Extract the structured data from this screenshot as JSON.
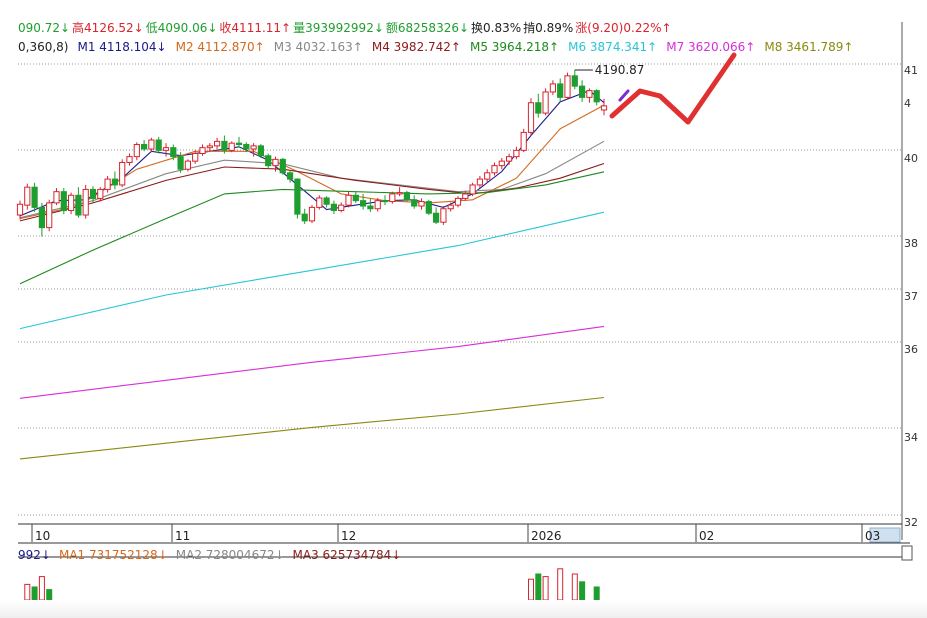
{
  "colors": {
    "up": "#d9232d",
    "down": "#1e9e2e",
    "annotation": "#e03030",
    "annotation_marker": "#7a2cd8",
    "grid": "#999999"
  },
  "top_bar": {
    "items": [
      {
        "text": "090.72↓",
        "color": "#1e9e2e"
      },
      {
        "text": "高4126.52↓",
        "color": "#d9232d"
      },
      {
        "text": "低4090.06↓",
        "color": "#1e9e2e"
      },
      {
        "text": "收4111.11↑",
        "color": "#d9232d"
      },
      {
        "text": "量393992992↓",
        "color": "#1e9e2e"
      },
      {
        "text": "额68258326↓",
        "color": "#1e9e2e"
      },
      {
        "text": "换0.83%",
        "color": "#222222"
      },
      {
        "text": "掯0.89%",
        "color": "#222222"
      },
      {
        "text": "涨(9.20)0.22%↑",
        "color": "#d9232d"
      }
    ]
  },
  "ma_bar": {
    "items": [
      {
        "text": "0,360,8)",
        "color": "#222222"
      },
      {
        "text": "M1 4118.104↓",
        "color": "#1a1a8c"
      },
      {
        "text": "M2 4112.870↑",
        "color": "#d2691e"
      },
      {
        "text": "M3 4032.163↑",
        "color": "#888888"
      },
      {
        "text": "M4 3982.742↑",
        "color": "#8b1a1a"
      },
      {
        "text": "M5 3964.218↑",
        "color": "#1e8a1e"
      },
      {
        "text": "M6 3874.341↑",
        "color": "#27c6d6"
      },
      {
        "text": "M7 3620.066↑",
        "color": "#d62fd6"
      },
      {
        "text": "M8 3461.789↑",
        "color": "#8a8a10"
      }
    ]
  },
  "vol_bar": {
    "items": [
      {
        "text": "992↓",
        "color": "#1a1a8c"
      },
      {
        "text": "MA1 731752128↓",
        "color": "#d2691e"
      },
      {
        "text": "MA2 728004672↓",
        "color": "#888888"
      },
      {
        "text": "MA3 625734784↓",
        "color": "#8b1a1a"
      }
    ]
  },
  "chart_data": {
    "type": "candlestick",
    "x_axis": {
      "tick_labels": [
        "10",
        "11",
        "12",
        "2026",
        "02",
        "03"
      ]
    },
    "y_axis": {
      "visible_tick_fragments": [
        "41",
        "4",
        "40",
        "38",
        "37",
        "36",
        "34",
        "32"
      ],
      "range": [
        3180,
        4280
      ]
    },
    "max_annotation": {
      "label": "4190.87",
      "value": 4190.87
    },
    "latest_bar": {
      "open": 4101.91,
      "high": 4126.52,
      "low": 4090.06,
      "close": 4111.11
    },
    "candles": [
      [
        3868,
        3900,
        3858,
        3892
      ],
      [
        3890,
        3938,
        3880,
        3930
      ],
      [
        3930,
        3940,
        3875,
        3885
      ],
      [
        3885,
        3895,
        3820,
        3840
      ],
      [
        3840,
        3902,
        3832,
        3895
      ],
      [
        3895,
        3928,
        3890,
        3920
      ],
      [
        3920,
        3928,
        3870,
        3878
      ],
      [
        3878,
        3918,
        3870,
        3912
      ],
      [
        3912,
        3930,
        3862,
        3868
      ],
      [
        3868,
        3935,
        3860,
        3925
      ],
      [
        3925,
        3932,
        3895,
        3905
      ],
      [
        3905,
        3930,
        3898,
        3925
      ],
      [
        3925,
        3955,
        3918,
        3948
      ],
      [
        3948,
        3965,
        3925,
        3935
      ],
      [
        3935,
        3992,
        3930,
        3985
      ],
      [
        3985,
        4005,
        3978,
        3998
      ],
      [
        3998,
        4030,
        3990,
        4025
      ],
      [
        4025,
        4035,
        4010,
        4015
      ],
      [
        4015,
        4040,
        4008,
        4035
      ],
      [
        4035,
        4042,
        4005,
        4012
      ],
      [
        4012,
        4028,
        3998,
        4018
      ],
      [
        4018,
        4025,
        3990,
        3998
      ],
      [
        3998,
        4008,
        3962,
        3970
      ],
      [
        3970,
        3992,
        3965,
        3988
      ],
      [
        3988,
        4012,
        3982,
        4005
      ],
      [
        4005,
        4025,
        4000,
        4018
      ],
      [
        4018,
        4028,
        4010,
        4022
      ],
      [
        4022,
        4040,
        4015,
        4032
      ],
      [
        4032,
        4045,
        4005,
        4012
      ],
      [
        4012,
        4032,
        4008,
        4028
      ],
      [
        4028,
        4042,
        4018,
        4025
      ],
      [
        4025,
        4030,
        4008,
        4015
      ],
      [
        4015,
        4028,
        3998,
        4022
      ],
      [
        4022,
        4026,
        3995,
        4000
      ],
      [
        4000,
        4005,
        3972,
        3978
      ],
      [
        3978,
        3998,
        3965,
        3992
      ],
      [
        3992,
        3995,
        3958,
        3962
      ],
      [
        3962,
        3968,
        3940,
        3948
      ],
      [
        3948,
        3950,
        3860,
        3870
      ],
      [
        3870,
        3882,
        3848,
        3855
      ],
      [
        3855,
        3890,
        3850,
        3885
      ],
      [
        3885,
        3912,
        3880,
        3906
      ],
      [
        3906,
        3910,
        3885,
        3892
      ],
      [
        3892,
        3900,
        3870,
        3878
      ],
      [
        3878,
        3896,
        3874,
        3890
      ],
      [
        3890,
        3920,
        3885,
        3912
      ],
      [
        3912,
        3920,
        3895,
        3900
      ],
      [
        3900,
        3915,
        3880,
        3888
      ],
      [
        3888,
        3904,
        3875,
        3882
      ],
      [
        3882,
        3906,
        3876,
        3900
      ],
      [
        3900,
        3912,
        3890,
        3898
      ],
      [
        3898,
        3920,
        3893,
        3915
      ],
      [
        3915,
        3930,
        3910,
        3918
      ],
      [
        3918,
        3922,
        3898,
        3902
      ],
      [
        3902,
        3912,
        3882,
        3888
      ],
      [
        3888,
        3905,
        3880,
        3898
      ],
      [
        3898,
        3902,
        3868,
        3872
      ],
      [
        3872,
        3885,
        3848,
        3852
      ],
      [
        3852,
        3888,
        3846,
        3882
      ],
      [
        3882,
        3896,
        3876,
        3890
      ],
      [
        3890,
        3910,
        3885,
        3905
      ],
      [
        3905,
        3922,
        3900,
        3915
      ],
      [
        3915,
        3940,
        3910,
        3935
      ],
      [
        3935,
        3955,
        3928,
        3948
      ],
      [
        3948,
        3970,
        3940,
        3962
      ],
      [
        3962,
        3985,
        3956,
        3978
      ],
      [
        3978,
        3995,
        3970,
        3988
      ],
      [
        3988,
        4005,
        3980,
        3998
      ],
      [
        3998,
        4020,
        3992,
        4012
      ],
      [
        4012,
        4060,
        4008,
        4052
      ],
      [
        4052,
        4128,
        4045,
        4118
      ],
      [
        4118,
        4138,
        4085,
        4095
      ],
      [
        4095,
        4150,
        4090,
        4142
      ],
      [
        4142,
        4168,
        4135,
        4160
      ],
      [
        4160,
        4172,
        4120,
        4130
      ],
      [
        4130,
        4185,
        4125,
        4178
      ],
      [
        4178,
        4190.87,
        4148,
        4155
      ],
      [
        4155,
        4168,
        4120,
        4130
      ],
      [
        4130,
        4150,
        4118,
        4145
      ],
      [
        4145,
        4148,
        4112,
        4120
      ],
      [
        4101.91,
        4126.52,
        4090.06,
        4111.11
      ]
    ],
    "moving_averages": [
      {
        "name": "M1",
        "color": "#1a1a8c",
        "last": 4118.104,
        "start": 3866,
        "anchors": [
          [
            0,
            3866
          ],
          [
            5,
            3900
          ],
          [
            9,
            3902
          ],
          [
            14,
            3950
          ],
          [
            18,
            4010
          ],
          [
            22,
            4000
          ],
          [
            26,
            4010
          ],
          [
            30,
            4020
          ],
          [
            34,
            3990
          ],
          [
            38,
            3935
          ],
          [
            42,
            3880
          ],
          [
            46,
            3890
          ],
          [
            50,
            3900
          ],
          [
            54,
            3902
          ],
          [
            58,
            3885
          ],
          [
            62,
            3915
          ],
          [
            66,
            3965
          ],
          [
            70,
            4045
          ],
          [
            74,
            4120
          ],
          [
            78,
            4145
          ],
          [
            80,
            4118.104
          ]
        ]
      },
      {
        "name": "M2",
        "color": "#d2691e",
        "last": 4112.87,
        "start": 3860,
        "anchors": [
          [
            0,
            3860
          ],
          [
            8,
            3888
          ],
          [
            16,
            3970
          ],
          [
            24,
            4010
          ],
          [
            32,
            4010
          ],
          [
            38,
            3965
          ],
          [
            44,
            3915
          ],
          [
            50,
            3900
          ],
          [
            56,
            3895
          ],
          [
            62,
            3902
          ],
          [
            68,
            3950
          ],
          [
            74,
            4060
          ],
          [
            80,
            4112.87
          ]
        ]
      },
      {
        "name": "M3",
        "color": "#888888",
        "last": 4032.163,
        "start": 3862,
        "anchors": [
          [
            0,
            3862
          ],
          [
            10,
            3900
          ],
          [
            20,
            3960
          ],
          [
            28,
            3990
          ],
          [
            36,
            3982
          ],
          [
            44,
            3950
          ],
          [
            52,
            3935
          ],
          [
            60,
            3920
          ],
          [
            66,
            3925
          ],
          [
            72,
            3960
          ],
          [
            80,
            4032.163
          ]
        ]
      },
      {
        "name": "M4",
        "color": "#8b1a1a",
        "last": 3982.742,
        "start": 3855,
        "anchors": [
          [
            0,
            3855
          ],
          [
            10,
            3895
          ],
          [
            20,
            3945
          ],
          [
            28,
            3975
          ],
          [
            36,
            3970
          ],
          [
            46,
            3945
          ],
          [
            56,
            3925
          ],
          [
            62,
            3915
          ],
          [
            68,
            3928
          ],
          [
            74,
            3950
          ],
          [
            80,
            3982.742
          ]
        ]
      },
      {
        "name": "M5",
        "color": "#1e8a1e",
        "last": 3964.218,
        "start": 3715,
        "anchors": [
          [
            0,
            3715
          ],
          [
            10,
            3790
          ],
          [
            20,
            3860
          ],
          [
            28,
            3915
          ],
          [
            36,
            3925
          ],
          [
            46,
            3920
          ],
          [
            56,
            3915
          ],
          [
            64,
            3918
          ],
          [
            72,
            3935
          ],
          [
            80,
            3964.218
          ]
        ]
      },
      {
        "name": "M6",
        "color": "#27c6d6",
        "last": 3874.341,
        "start": 3615,
        "anchors": [
          [
            0,
            3615
          ],
          [
            20,
            3690
          ],
          [
            40,
            3745
          ],
          [
            60,
            3800
          ],
          [
            80,
            3874.341
          ]
        ]
      },
      {
        "name": "M7",
        "color": "#d62fd6",
        "last": 3620.066,
        "start": 3460,
        "anchors": [
          [
            0,
            3460
          ],
          [
            20,
            3500
          ],
          [
            40,
            3540
          ],
          [
            60,
            3575
          ],
          [
            80,
            3620.066
          ]
        ]
      },
      {
        "name": "M8",
        "color": "#8a8a10",
        "last": 3461.789,
        "start": 3325,
        "anchors": [
          [
            0,
            3325
          ],
          [
            20,
            3360
          ],
          [
            40,
            3395
          ],
          [
            60,
            3425
          ],
          [
            80,
            3461.789
          ]
        ]
      }
    ],
    "volume": [
      {
        "i": 1,
        "v": 0.6,
        "up": true
      },
      {
        "i": 2,
        "v": 0.5,
        "up": false
      },
      {
        "i": 3,
        "v": 0.9,
        "up": true
      },
      {
        "i": 4,
        "v": 0.4,
        "up": false
      },
      {
        "i": 70,
        "v": 0.8,
        "up": true
      },
      {
        "i": 71,
        "v": 1.0,
        "up": false
      },
      {
        "i": 72,
        "v": 0.9,
        "up": true
      },
      {
        "i": 74,
        "v": 1.2,
        "up": true
      },
      {
        "i": 76,
        "v": 1.0,
        "up": true
      },
      {
        "i": 77,
        "v": 0.7,
        "up": false
      },
      {
        "i": 79,
        "v": 0.5,
        "up": false
      }
    ]
  }
}
